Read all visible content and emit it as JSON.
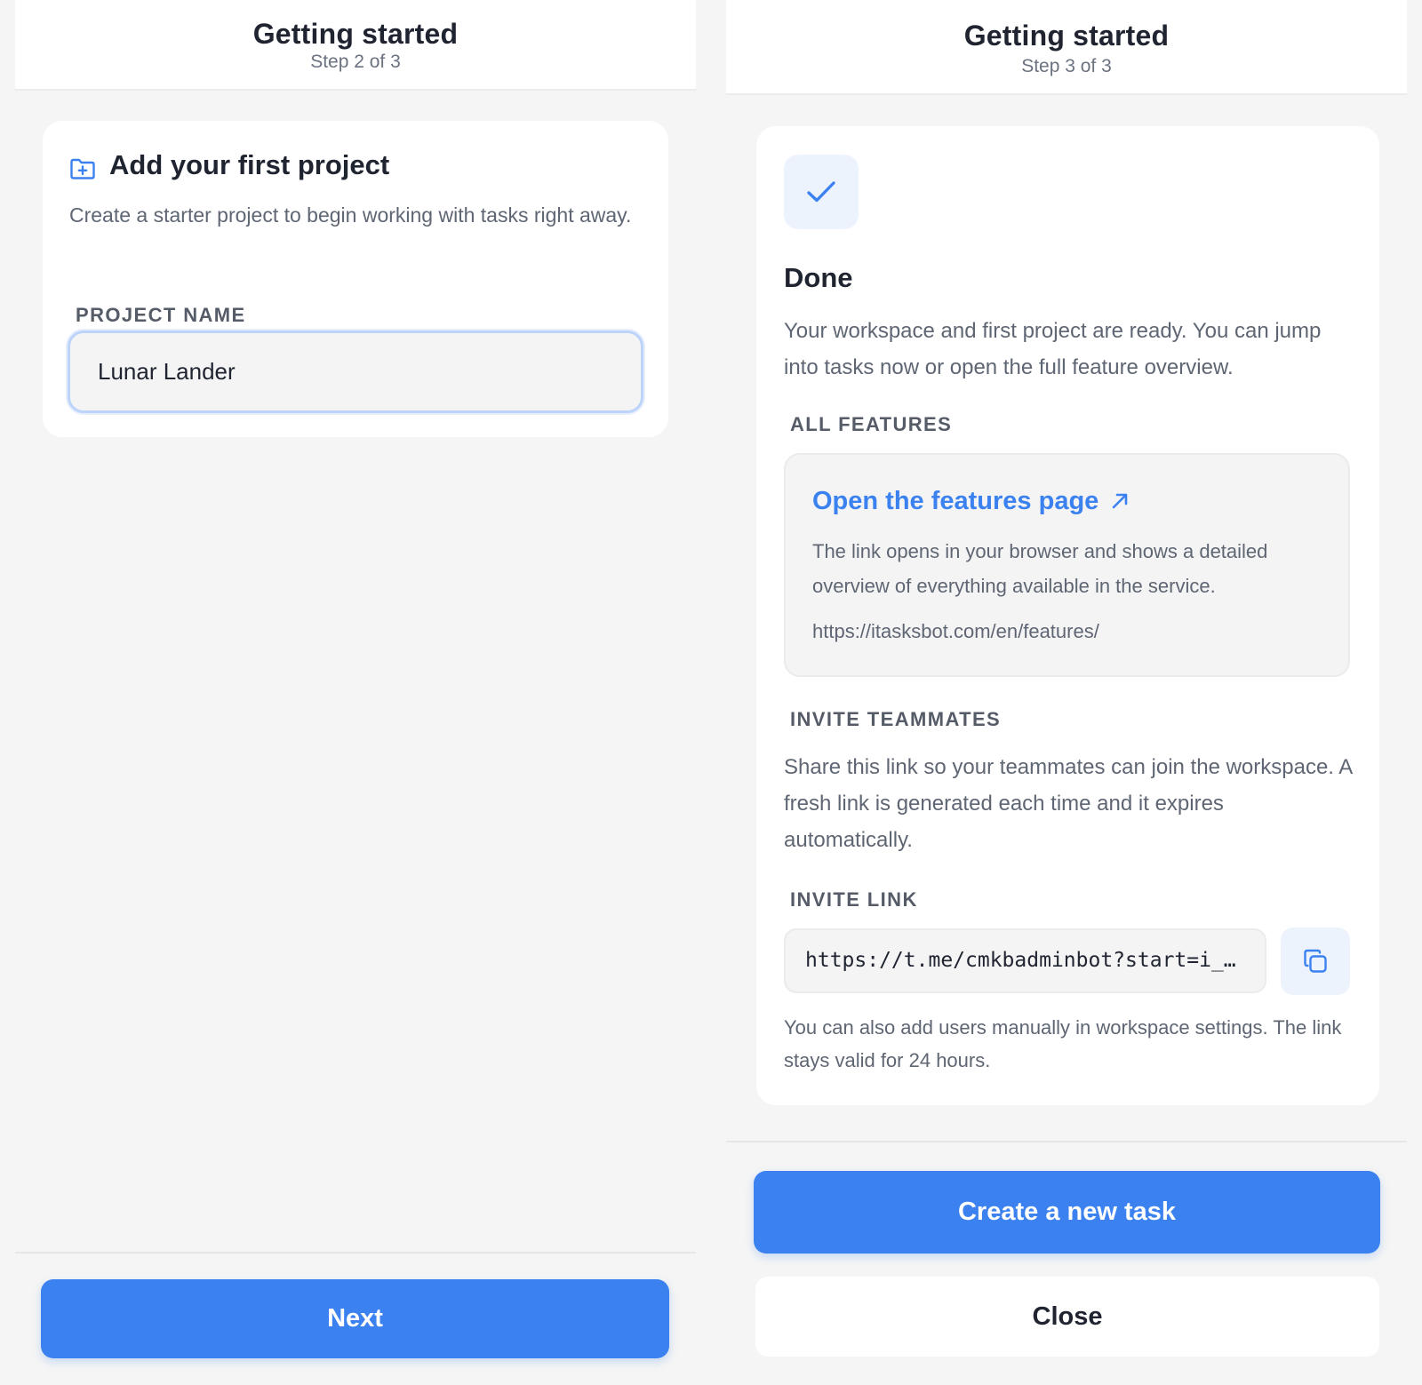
{
  "step2": {
    "header": {
      "title": "Getting started",
      "step": "Step 2 of 3"
    },
    "card": {
      "icon": "folder-plus-icon",
      "title": "Add your first project",
      "description": "Create a starter project to begin working with tasks right away.",
      "project_name_label": "PROJECT NAME",
      "project_name_value": "Lunar Lander"
    },
    "next_label": "Next"
  },
  "step3": {
    "header": {
      "title": "Getting started",
      "step": "Step 3 of 3"
    },
    "card": {
      "icon": "check-icon",
      "title": "Done",
      "description": "Your workspace and first project are ready. You can jump into tasks now or open the full feature overview.",
      "features_label": "ALL FEATURES",
      "features_link": "Open the features page",
      "features_desc": "The link opens in your browser and shows a detailed overview of everything available in the service.",
      "features_url": "https://itasksbot.com/en/features/",
      "invite_label": "INVITE TEAMMATES",
      "invite_desc": "Share this link so your teammates can join the workspace. A fresh link is generated each time and it expires automatically.",
      "invite_link_label": "INVITE LINK",
      "invite_link_value": "https://t.me/cmkbadminbot?start=i_…",
      "invite_note": "You can also add users manually in workspace settings. The link stays valid for 24 hours."
    },
    "create_task_label": "Create a new task",
    "close_label": "Close"
  },
  "colors": {
    "accent": "#3b82f0",
    "background": "#f5f5f5",
    "card": "#ffffff",
    "icon_tile": "#edf3fd"
  }
}
